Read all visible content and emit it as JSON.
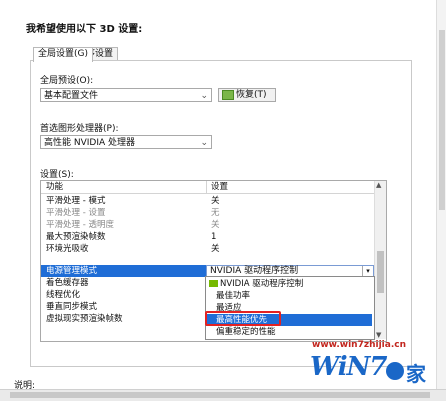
{
  "heading": "我希望使用以下 3D 设置:",
  "tabs": [
    {
      "label": "全局设置(G)"
    },
    {
      "label": "程序设置"
    }
  ],
  "global_preset": {
    "label": "全局预设(O):",
    "value": "基本配置文件",
    "restore_label": "恢复(T)"
  },
  "gpu": {
    "label": "首选图形处理器(P):",
    "value": "高性能 NVIDIA 处理器"
  },
  "settings": {
    "label": "设置(S):",
    "col_feature": "功能",
    "col_setting": "设置",
    "rows": [
      {
        "feature": "平滑处理 - 模式",
        "setting": "关"
      },
      {
        "feature": "平滑处理 - 设置",
        "setting": "无"
      },
      {
        "feature": "平滑处理 - 透明度",
        "setting": "关"
      },
      {
        "feature": "最大预渲染帧数",
        "setting": "1"
      },
      {
        "feature": "环境光吸收",
        "setting": "关"
      },
      {
        "feature": "电源管理模式",
        "setting": "NVIDIA 驱动程序控制"
      },
      {
        "feature": "着色缓存器",
        "setting": ""
      },
      {
        "feature": "线程优化",
        "setting": ""
      },
      {
        "feature": "垂直同步模式",
        "setting": ""
      },
      {
        "feature": "虚拟现实预渲染帧数",
        "setting": ""
      }
    ],
    "dropdown_options": [
      {
        "label": "NVIDIA 驱动程序控制"
      },
      {
        "label": "最佳功率"
      },
      {
        "label": "最适应"
      },
      {
        "label": "最高性能优先"
      },
      {
        "label": "偏重稳定的性能"
      }
    ]
  },
  "description_label": "说明:",
  "watermark": {
    "url": "www.win7zhijia.cn",
    "logo_text": "WiN7",
    "logo_char": "家"
  },
  "colors": {
    "selection": "#1f6dd6",
    "highlight_box": "#e32222",
    "nvidia_green": "#76b900"
  }
}
